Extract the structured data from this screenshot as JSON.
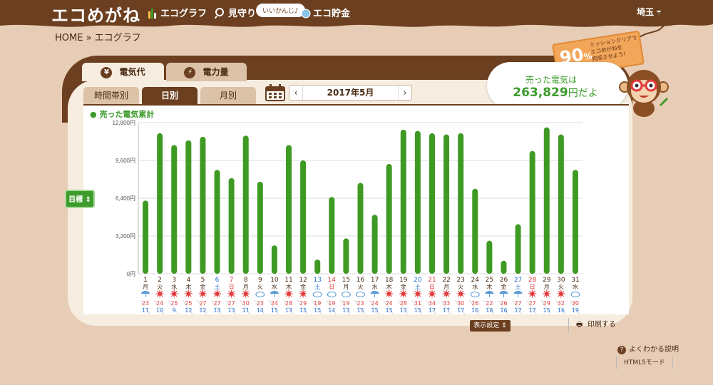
{
  "header": {
    "logo": "エコめがね",
    "nav": [
      {
        "label": "エコグラフ",
        "icon": "bar-chart-icon"
      },
      {
        "label": "見守り",
        "icon": "magnifier-icon"
      },
      {
        "label": "エコ貯金",
        "icon": "coin-icon"
      }
    ],
    "bubble": "いいかんじ♪",
    "user": "埼玉 ▾"
  },
  "breadcrumb": "HOME » エコグラフ",
  "main_tabs": [
    {
      "label": "電気代",
      "icon": "yen-icon"
    },
    {
      "label": "電力量",
      "icon": "lightning-icon"
    }
  ],
  "sub_tabs": [
    "時間帯別",
    "日別",
    "月別"
  ],
  "date": {
    "label": "2017年5月",
    "prev": "‹",
    "next": "›"
  },
  "sold": {
    "line1": "売った電気は",
    "amount": "263,829",
    "suffix": "円だよ"
  },
  "mission": {
    "percent": "90",
    "unit": "%",
    "text": "ミッションクリアで\nエコめがねを\n完成させよう!"
  },
  "goal_button": "目標 ⇕",
  "buttons": {
    "display_settings": "表示設定 ⇕",
    "print": "印刷する"
  },
  "help_link": "よくわかる説明",
  "html5": "HTML5モード",
  "chart_data": {
    "type": "bar",
    "title": "売った電気累計",
    "ylim": [
      0,
      12800
    ],
    "yticks": [
      "0円",
      "3,200円",
      "6,400円",
      "9,600円",
      "12,800円"
    ],
    "color": "#3f9a24",
    "days": [
      "1",
      "2",
      "3",
      "4",
      "5",
      "6",
      "7",
      "8",
      "9",
      "10",
      "11",
      "12",
      "13",
      "14",
      "15",
      "16",
      "17",
      "18",
      "19",
      "20",
      "21",
      "22",
      "23",
      "24",
      "25",
      "26",
      "27",
      "28",
      "29",
      "30",
      "31"
    ],
    "weekdays": [
      "月",
      "火",
      "水",
      "木",
      "金",
      "土",
      "日",
      "月",
      "火",
      "水",
      "木",
      "金",
      "土",
      "日",
      "月",
      "火",
      "水",
      "木",
      "金",
      "土",
      "日",
      "月",
      "火",
      "水",
      "木",
      "金",
      "土",
      "日",
      "月",
      "火",
      "水"
    ],
    "values": [
      6200,
      11900,
      10900,
      11300,
      11600,
      8800,
      8100,
      11700,
      7800,
      2400,
      10900,
      9600,
      1200,
      6500,
      3000,
      7700,
      5000,
      9300,
      12200,
      12100,
      11900,
      11800,
      11900,
      7200,
      2800,
      1100,
      4200,
      10400,
      12400,
      11800,
      8800
    ],
    "weather": [
      "rain",
      "sun",
      "sun",
      "sun",
      "sun",
      "sun",
      "sun",
      "sun",
      "cloud",
      "rain",
      "sun",
      "sun",
      "cloud",
      "cloud",
      "cloud",
      "cloud",
      "rain",
      "sun",
      "sun",
      "sun",
      "sun",
      "sun",
      "sun",
      "cloud",
      "rain",
      "rain",
      "rain",
      "sun",
      "sun",
      "sun",
      "cloud"
    ],
    "high": [
      "23",
      "24",
      "25",
      "25",
      "27",
      "27",
      "27",
      "30",
      "23",
      "24",
      "28",
      "29",
      "19",
      "19",
      "19",
      "23",
      "24",
      "24",
      "28",
      "31",
      "34",
      "33",
      "30",
      "26",
      "22",
      "26",
      "27",
      "27",
      "29",
      "32",
      "30"
    ],
    "low": [
      "11",
      "10",
      "9",
      "12",
      "12",
      "13",
      "13",
      "11",
      "14",
      "15",
      "13",
      "15",
      "15",
      "14",
      "13",
      "15",
      "15",
      "15",
      "13",
      "15",
      "17",
      "17",
      "17",
      "16",
      "18",
      "16",
      "17",
      "17",
      "15",
      "16",
      "19"
    ]
  },
  "colors": {
    "brown": "#6b3f1f",
    "cream": "#f6ecdf",
    "green": "#3f9a24",
    "red": "#e03a3a",
    "blue": "#2a6fd6",
    "bg": "#e8cdb6"
  }
}
